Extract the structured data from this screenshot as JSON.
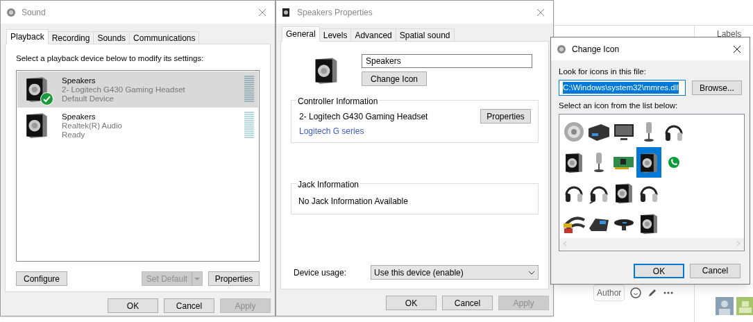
{
  "background_page": {
    "sidebar_heading": "Labels",
    "author_badge": "Author"
  },
  "sound_window": {
    "title": "Sound",
    "tabs": [
      {
        "label": "Playback",
        "selected": true
      },
      {
        "label": "Recording",
        "selected": false
      },
      {
        "label": "Sounds",
        "selected": false
      },
      {
        "label": "Communications",
        "selected": false
      }
    ],
    "instruction": "Select a playback device below to modify its settings:",
    "devices": [
      {
        "name": "Speakers",
        "driver": "2- Logitech G430 Gaming Headset",
        "status": "Default Device",
        "default": true,
        "selected": true
      },
      {
        "name": "Speakers",
        "driver": "Realtek(R) Audio",
        "status": "Ready",
        "default": false,
        "selected": false
      }
    ],
    "buttons": [
      {
        "label": "Configure",
        "disabled": false
      },
      {
        "label": "Set Default",
        "disabled": true,
        "kind": "split"
      },
      {
        "label": "Properties",
        "disabled": false
      }
    ],
    "dialog_buttons": [
      {
        "label": "OK",
        "disabled": false
      },
      {
        "label": "Cancel",
        "disabled": false
      },
      {
        "label": "Apply",
        "disabled": true
      }
    ]
  },
  "properties_window": {
    "title": "Speakers Properties",
    "tabs": [
      {
        "label": "General",
        "selected": true
      },
      {
        "label": "Levels",
        "selected": false
      },
      {
        "label": "Advanced",
        "selected": false
      },
      {
        "label": "Spatial sound",
        "selected": false
      }
    ],
    "name_value": "Speakers",
    "change_icon_button": "Change Icon",
    "controller": {
      "heading": "Controller Information",
      "device": "2- Logitech G430 Gaming Headset",
      "link": "Logitech G series",
      "button": "Properties"
    },
    "jack": {
      "heading": "Jack Information",
      "text": "No Jack Information Available"
    },
    "device_usage": {
      "label": "Device usage:",
      "value": "Use this device (enable)"
    },
    "dialog_buttons": [
      {
        "label": "OK",
        "disabled": false
      },
      {
        "label": "Cancel",
        "disabled": false
      },
      {
        "label": "Apply",
        "disabled": true
      }
    ]
  },
  "change_icon_window": {
    "title": "Change Icon",
    "file_label": "Look for icons in this file:",
    "file_value": "C:\\Windows\\system32\\mmres.dll",
    "browse_button": "Browse...",
    "list_label": "Select an icon from the list below:",
    "icons": [
      [
        {
          "kind": "round-speaker",
          "selected": false
        },
        {
          "kind": "receiver",
          "selected": false
        },
        {
          "kind": "monitor",
          "selected": false
        },
        {
          "kind": "microphone",
          "selected": false
        },
        {
          "kind": "headphones",
          "selected": false
        }
      ],
      [
        {
          "kind": "speaker-box",
          "selected": false
        },
        {
          "kind": "microphone",
          "selected": false
        },
        {
          "kind": "sound-card",
          "selected": false
        },
        {
          "kind": "speaker-box",
          "selected": true
        },
        {
          "kind": "phone",
          "selected": false
        }
      ],
      [
        {
          "kind": "headphones",
          "selected": false
        },
        {
          "kind": "headset",
          "selected": false
        },
        {
          "kind": "speaker-box",
          "selected": false
        },
        {
          "kind": "headphones",
          "selected": false
        }
      ],
      [
        {
          "kind": "cable",
          "selected": false
        },
        {
          "kind": "desk-phone",
          "selected": false
        },
        {
          "kind": "speakerphone",
          "selected": false
        },
        {
          "kind": "speaker-box",
          "selected": false
        }
      ]
    ],
    "ok_button": "OK",
    "cancel_button": "Cancel"
  }
}
